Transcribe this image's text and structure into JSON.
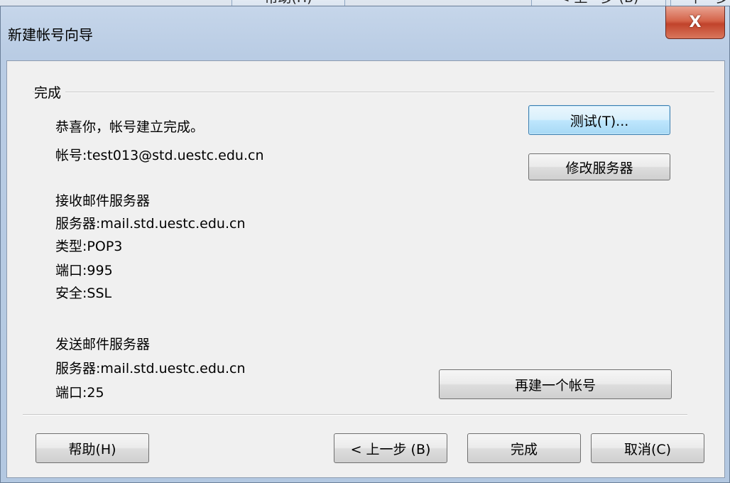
{
  "background": {
    "help_label": "帮助(H)",
    "back_label": "< 上一步 (B)",
    "next_label": "下一步"
  },
  "dialog": {
    "title": "新建帐号向导",
    "close_label": "X"
  },
  "group": {
    "title": "完成"
  },
  "content": {
    "congrats": "恭喜你，帐号建立完成。",
    "account": "帐号:test013@std.uestc.edu.cn",
    "incoming_heading": "接收邮件服务器",
    "incoming_server": "服务器:mail.std.uestc.edu.cn",
    "incoming_type": "类型:POP3",
    "incoming_port": "端口:995",
    "incoming_security": "安全:SSL",
    "outgoing_heading": "发送邮件服务器",
    "outgoing_server": "服务器:mail.std.uestc.edu.cn",
    "outgoing_port": "端口:25"
  },
  "buttons": {
    "test": "测试(T)...",
    "modify_server": "修改服务器",
    "create_another": "再建一个帐号",
    "help": "帮助(H)",
    "back": "< 上一步 (B)",
    "finish": "完成",
    "cancel": "取消(C)"
  }
}
